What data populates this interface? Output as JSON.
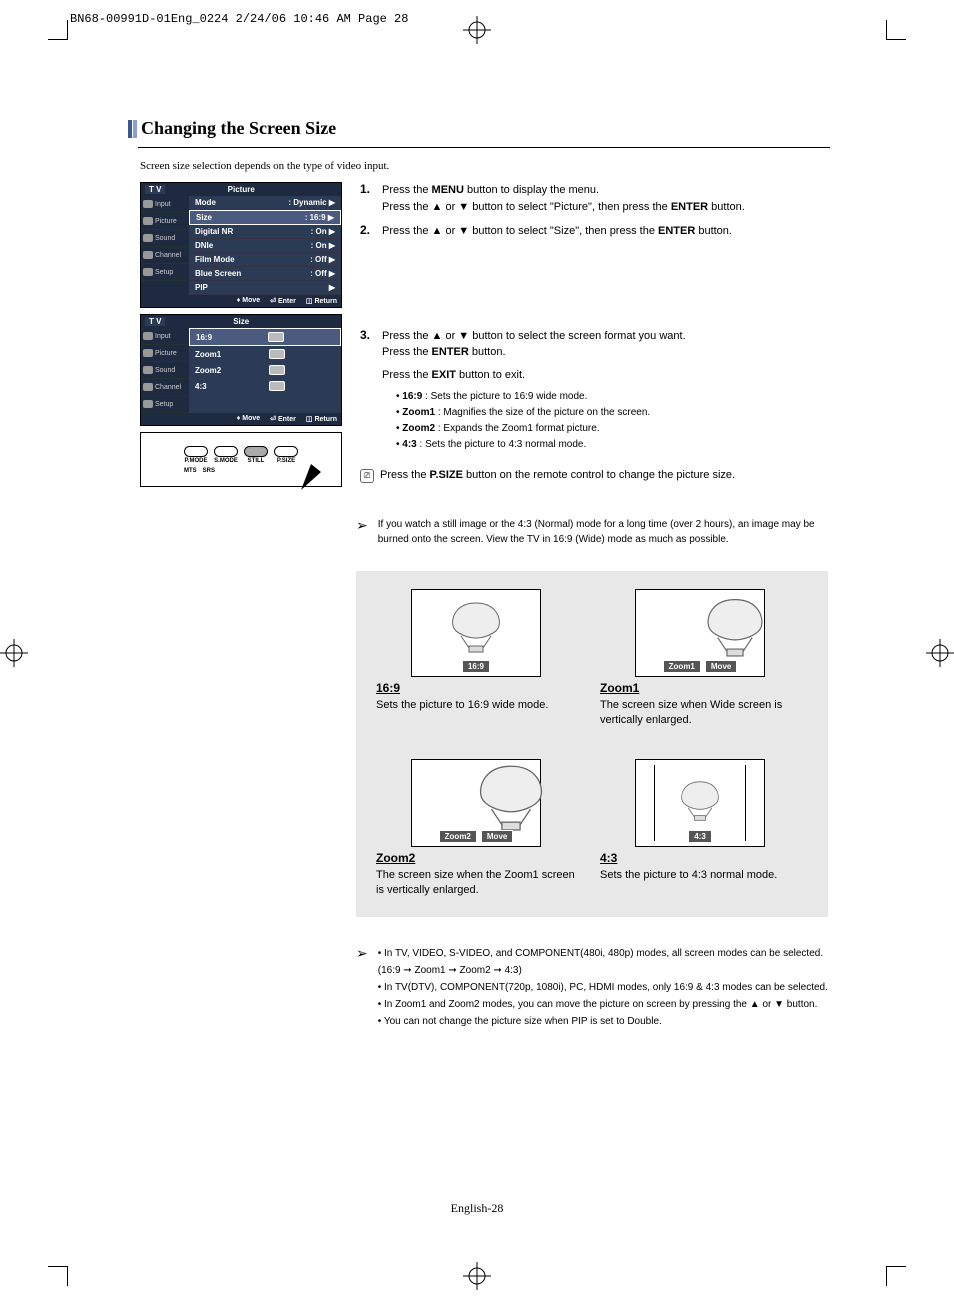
{
  "header_line": "BN68-00991D-01Eng_0224  2/24/06  10:46 AM  Page 28",
  "title": "Changing the Screen Size",
  "intro": "Screen size selection depends on the type of video input.",
  "osd1": {
    "tv": "T V",
    "title": "Picture",
    "side": [
      "Input",
      "Picture",
      "Sound",
      "Channel",
      "Setup"
    ],
    "rows": [
      {
        "label": "Mode",
        "value": ": Dynamic"
      },
      {
        "label": "Size",
        "value": ": 16:9"
      },
      {
        "label": "Digital NR",
        "value": ": On"
      },
      {
        "label": "DNIe",
        "value": ": On"
      },
      {
        "label": "Film Mode",
        "value": ": Off"
      },
      {
        "label": "Blue Screen",
        "value": ": Off"
      },
      {
        "label": "PIP",
        "value": ""
      }
    ],
    "footer": {
      "move": "Move",
      "enter": "Enter",
      "return": "Return"
    }
  },
  "osd2": {
    "tv": "T V",
    "title": "Size",
    "side": [
      "Input",
      "Picture",
      "Sound",
      "Channel",
      "Setup"
    ],
    "rows": [
      "16:9",
      "Zoom1",
      "Zoom2",
      "4:3"
    ],
    "footer": {
      "move": "Move",
      "enter": "Enter",
      "return": "Return"
    }
  },
  "remote": {
    "b1": "P.MODE",
    "b2": "S.MODE",
    "b3": "STILL",
    "b4": "P.SIZE",
    "b5": "MTS",
    "b6": "SRS"
  },
  "steps": {
    "s1a": "Press the ",
    "s1a_b": "MENU",
    "s1a_end": " button to display the menu.",
    "s1b": "Press the ▲ or ▼ button to select \"Picture\", then press the ",
    "s1b_b": "ENTER",
    "s1b_end": " button.",
    "s2": "Press the ▲ or ▼ button to select \"Size\",  then press the ",
    "s2_b": "ENTER",
    "s2_end": " button.",
    "s3a": "Press the ▲ or ▼ button to select the screen format you want.",
    "s3b": "Press the ",
    "s3b_b": "ENTER",
    "s3b_end": " button.",
    "s3c": "Press the ",
    "s3c_b": "EXIT",
    "s3c_end": " button to exit.",
    "b1a": "16:9",
    "b1b": " : Sets the picture to 16:9 wide mode.",
    "b2a": "Zoom1",
    "b2b": " : Magnifies the size of the picture on the screen.",
    "b3a": "Zoom2",
    "b3b": " : Expands the Zoom1 format picture.",
    "b4a": "4:3",
    "b4b": " : Sets the picture to 4:3 normal mode."
  },
  "psize_note_a": "Press the ",
  "psize_note_b": "P.SIZE",
  "psize_note_c": " button on the remote control to change the picture size.",
  "warn1": "If you watch a still image or the 4:3 (Normal) mode for a long time (over 2 hours), an image may be burned onto the screen. View the TV in 16:9 (Wide) mode as much as possible.",
  "modes": {
    "m1": {
      "chip1": "16:9",
      "title": "16:9",
      "desc": "Sets the picture to 16:9 wide mode."
    },
    "m2": {
      "chip1": "Zoom1",
      "chip2": "Move",
      "title": "Zoom1",
      "desc": "The screen size when Wide screen is vertically enlarged."
    },
    "m3": {
      "chip1": "Zoom2",
      "chip2": "Move",
      "title": "Zoom2",
      "desc": "The screen size when the Zoom1 screen is vertically enlarged."
    },
    "m4": {
      "chip1": "4:3",
      "title": "4:3",
      "desc": "Sets the picture to 4:3 normal mode."
    }
  },
  "bottom_notes": [
    "In TV, VIDEO, S-VIDEO, and COMPONENT(480i, 480p) modes, all screen modes can be selected. (16:9 ➞ Zoom1 ➞ Zoom2 ➞ 4:3)",
    "In TV(DTV), COMPONENT(720p, 1080i), PC, HDMI modes, only 16:9 & 4:3 modes can be selected.",
    "In Zoom1 and Zoom2 modes, you can move the picture on screen by pressing the ▲ or ▼ button.",
    "You can not change the picture size when PIP is set to Double."
  ],
  "page_footer": "English-28"
}
